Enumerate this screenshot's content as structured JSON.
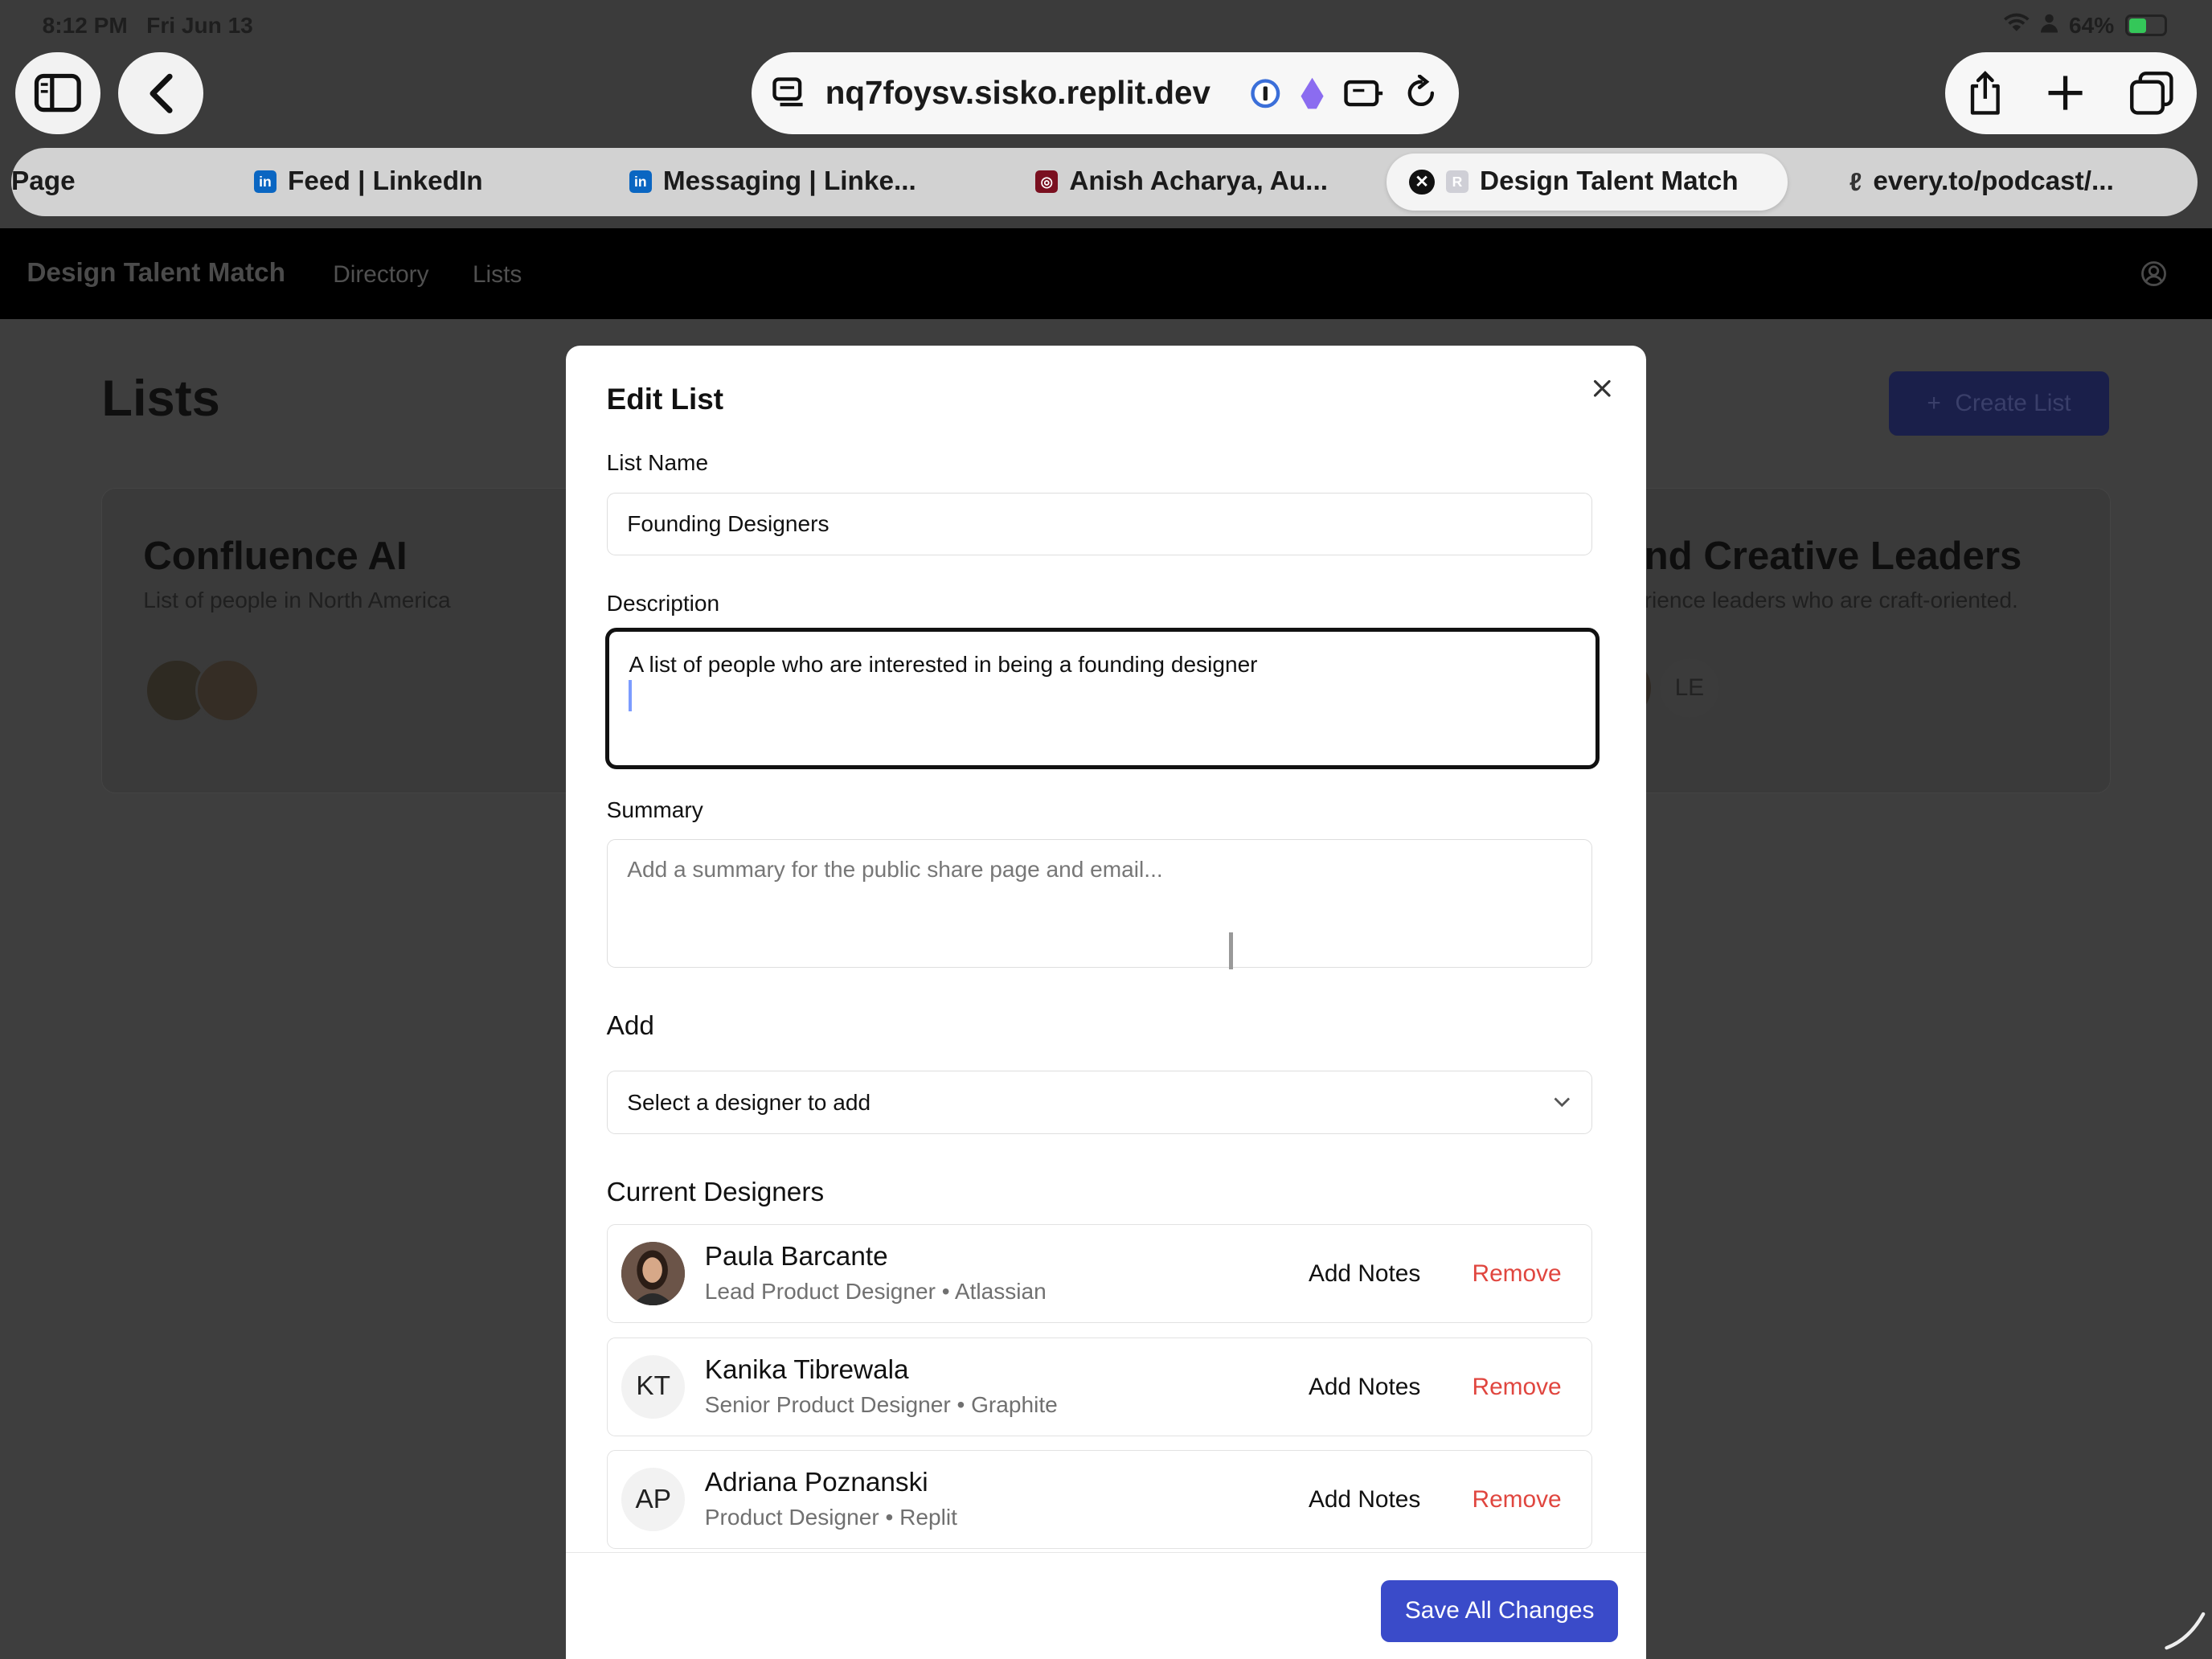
{
  "status": {
    "time": "8:12 PM",
    "date": "Fri Jun 13",
    "battery": "64%"
  },
  "browser": {
    "url": "nq7foysv.sisko.replit.dev",
    "tabs": [
      {
        "label": "Page",
        "icon": "page-icon"
      },
      {
        "label": "Feed | LinkedIn",
        "icon": "linkedin-icon"
      },
      {
        "label": "Messaging | Linke...",
        "icon": "linkedin-icon"
      },
      {
        "label": "Anish Acharya, Au...",
        "icon": "podcast-icon"
      },
      {
        "label": "Design Talent Match",
        "icon": "replit-icon",
        "active": true
      },
      {
        "label": "every.to/podcast/...",
        "icon": "link-icon"
      }
    ]
  },
  "app": {
    "brand": "Design Talent Match",
    "nav": [
      "Directory",
      "Lists"
    ],
    "page_title": "Lists",
    "create_button": "Create List",
    "cards": [
      {
        "title": "Confluence AI",
        "description": "List of people in North America"
      },
      {
        "title": "nd Creative Leaders",
        "description": "rience leaders who are craft-oriented.",
        "avatar_initials": "LE"
      }
    ]
  },
  "modal": {
    "title": "Edit List",
    "list_name_label": "List Name",
    "list_name_value": "Founding Designers",
    "description_label": "Description",
    "description_value": "A list of people who are interested in being a founding designer",
    "summary_label": "Summary",
    "summary_placeholder": "Add a summary for the public share page and email...",
    "add_label": "Add",
    "add_select_value": "Select a designer to add",
    "current_label": "Current Designers",
    "designers": [
      {
        "name": "Paula Barcante",
        "role": "Lead Product Designer • Atlassian",
        "initials": ""
      },
      {
        "name": "Kanika Tibrewala",
        "role": "Senior Product Designer • Graphite",
        "initials": "KT"
      },
      {
        "name": "Adriana Poznanski",
        "role": "Product Designer • Replit",
        "initials": "AP"
      }
    ],
    "add_notes_label": "Add Notes",
    "remove_label": "Remove",
    "save_button": "Save All Changes"
  }
}
